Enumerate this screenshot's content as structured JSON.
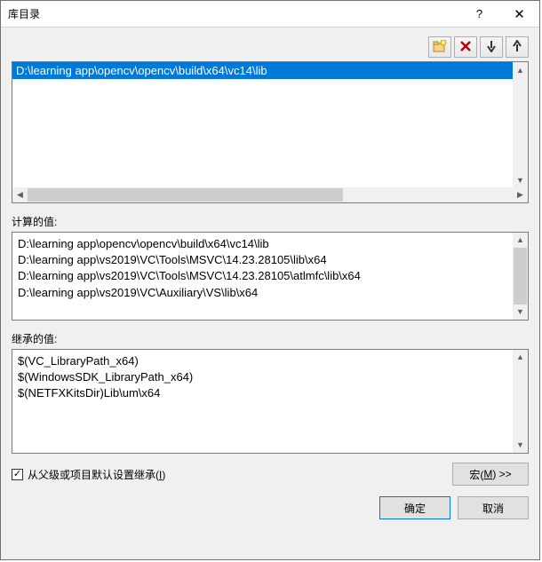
{
  "titlebar": {
    "title": "库目录"
  },
  "toolbar": {
    "new_folder_icon": "new-folder-icon",
    "delete_icon": "delete-icon",
    "down_icon": "arrow-down-icon",
    "up_icon": "arrow-up-icon"
  },
  "editable_list": {
    "items": [
      "D:\\learning app\\opencv\\opencv\\build\\x64\\vc14\\lib"
    ],
    "selected_index": 0
  },
  "computed": {
    "label": "计算的值:",
    "lines": [
      "D:\\learning app\\opencv\\opencv\\build\\x64\\vc14\\lib",
      "D:\\learning app\\vs2019\\VC\\Tools\\MSVC\\14.23.28105\\lib\\x64",
      "D:\\learning app\\vs2019\\VC\\Tools\\MSVC\\14.23.28105\\atlmfc\\lib\\x64",
      "D:\\learning app\\vs2019\\VC\\Auxiliary\\VS\\lib\\x64"
    ]
  },
  "inherited": {
    "label": "继承的值:",
    "lines": [
      "$(VC_LibraryPath_x64)",
      "$(WindowsSDK_LibraryPath_x64)",
      "$(NETFXKitsDir)Lib\\um\\x64"
    ]
  },
  "inherit_checkbox": {
    "checked": true,
    "label_prefix": "从父级或项目默认设置继承(",
    "label_key": "I",
    "label_suffix": ")"
  },
  "macro_button": {
    "label_prefix": "宏(",
    "label_key": "M",
    "label_suffix": ") >>"
  },
  "buttons": {
    "ok": "确定",
    "cancel": "取消"
  }
}
